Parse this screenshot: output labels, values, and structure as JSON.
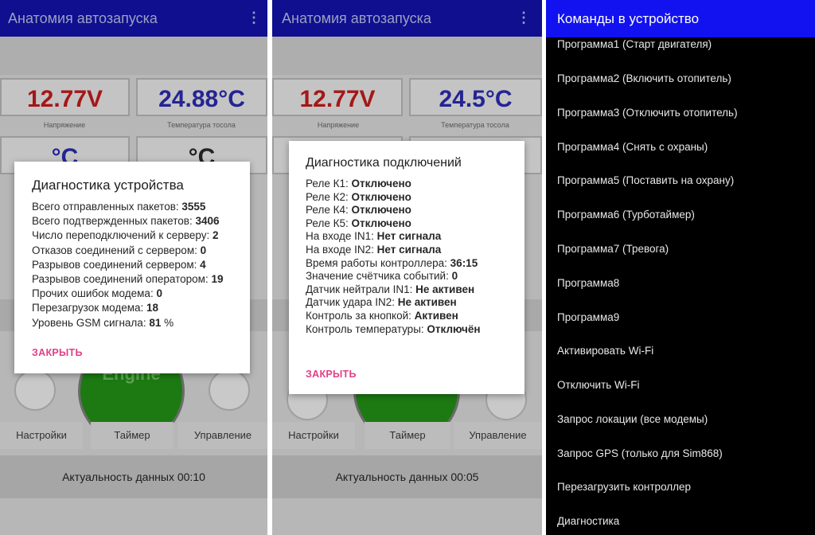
{
  "app": {
    "title": "Анатомия автозапуска"
  },
  "screen1": {
    "voltage": "12.77V",
    "temperature": "24.88°C",
    "voltage_label": "Напряжение",
    "temperature_label": "Температура тосола",
    "row2_left": "°C",
    "row2_right": "°C",
    "engine_label": "Engine",
    "buttons": [
      "Настройки",
      "Таймер",
      "Управление"
    ],
    "status": "Актуальность данных 00:10",
    "dialog": {
      "title": "Диагностика устройства",
      "lines": [
        {
          "label": "Всего отправленных пакетов: ",
          "value": "3555"
        },
        {
          "label": "Всего подтвержденных пакетов: ",
          "value": "3406"
        },
        {
          "label": "Число переподключений к серверу: ",
          "value": "2"
        },
        {
          "label": "Отказов соединений с сервером: ",
          "value": "0"
        },
        {
          "label": "Разрывов соединений сервером: ",
          "value": "4"
        },
        {
          "label": "Разрывов соединений оператором: ",
          "value": "19"
        },
        {
          "label": "Прочих ошибок модема: ",
          "value": "0"
        },
        {
          "label": "Перезагрузок модема: ",
          "value": "18"
        },
        {
          "label": "Уровень GSM сигнала: ",
          "value": "81",
          "suffix": " %"
        }
      ],
      "close": "ЗАКРЫТЬ"
    }
  },
  "screen2": {
    "voltage": "12.77V",
    "temperature": "24.5°C",
    "voltage_label": "Напряжение",
    "temperature_label": "Температура тосола",
    "row2_left": "°C",
    "buttons": [
      "Настройки",
      "Таймер",
      "Управление"
    ],
    "status": "Актуальность данных 00:05",
    "dialog": {
      "title": "Диагностика подключений",
      "lines": [
        {
          "label": "Реле К1: ",
          "value": "Отключено"
        },
        {
          "label": "Реле К2: ",
          "value": "Отключено"
        },
        {
          "label": "Реле К4: ",
          "value": "Отключено"
        },
        {
          "label": "Реле К5: ",
          "value": "Отключено"
        },
        {
          "label": "На входе IN1: ",
          "value": "Нет сигнала"
        },
        {
          "label": "На входе IN2: ",
          "value": "Нет сигнала"
        },
        {
          "label": "Время работы контроллера: ",
          "value": "36:15"
        },
        {
          "label": "Значение счётчика событий: ",
          "value": "0"
        },
        {
          "label": "Датчик нейтрали IN1: ",
          "value": "Не активен"
        },
        {
          "label": "Датчик удара IN2: ",
          "value": "Не активен"
        },
        {
          "label": "Контроль за кнопкой: ",
          "value": "Активен"
        },
        {
          "label": "Контроль температуры: ",
          "value": "Отключён"
        }
      ],
      "close": "ЗАКРЫТЬ"
    }
  },
  "screen3": {
    "title": "Команды в устройство",
    "items": [
      "Программа1 (Старт двигателя)",
      "Программа2 (Включить отопитель)",
      "Программа3 (Отключить отопитель)",
      "Программа4 (Снять с охраны)",
      "Программа5 (Поставить на охрану)",
      "Программа6 (Турботаймер)",
      "Программа7 (Тревога)",
      "Программа8",
      "Программа9",
      "Активировать Wi-Fi",
      "Отключить Wi-Fi",
      "Запрос локации (все модемы)",
      "Запрос GPS (только для Sim868)",
      "Перезагрузить контроллер",
      "Диагностика"
    ]
  },
  "colors": {
    "appbar": "#0f0f8f",
    "drawer_header": "#1212f0",
    "voltage_red": "#a51717",
    "temperature_blue": "#242493",
    "accent_pink": "#e04188"
  }
}
